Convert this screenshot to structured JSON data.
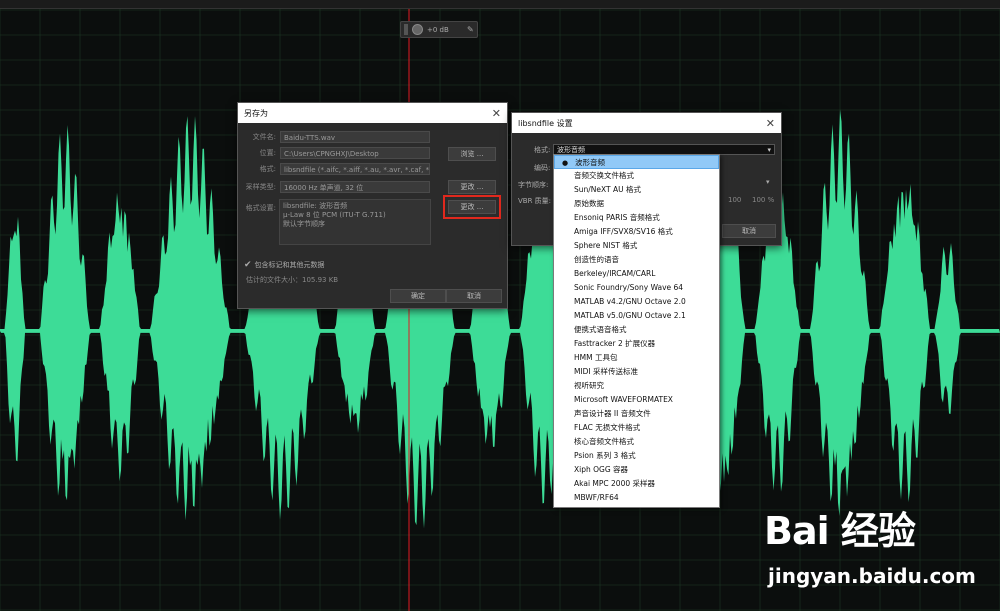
{
  "colors": {
    "waveform": "#3ddc97",
    "grid": "#1e3a26",
    "playhead": "#e01b24",
    "highlight": "#e0281d",
    "selection": "#91c9f7"
  },
  "volume": {
    "value": "+0 dB"
  },
  "save_as": {
    "title": "另存为",
    "fields": [
      {
        "label": "文件名:",
        "value": "Baidu-TTS.wav"
      },
      {
        "label": "位置:",
        "value": "C:\\Users\\CPNGHXJ\\Desktop"
      },
      {
        "label": "格式:",
        "value": "libsndfile (*.aifc, *.aiff, *.au, *.avr, *.caf, *.flac, *"
      },
      {
        "label": "采样类型:",
        "value": "16000 Hz 单声道, 32 位"
      }
    ],
    "format_settings_label": "格式设置:",
    "format_settings_lines": [
      "libsndfile: 波形音频",
      "μ-Law 8 位 PCM (ITU-T G.711)",
      "默认字节顺序"
    ],
    "browse_label": "浏览 ...",
    "change_label_1": "更改 ...",
    "change_label_2": "更改 ...",
    "include_label": "包含标记和其他元数据",
    "estimate_label": "估计的文件大小：105.93 KB",
    "ok_label": "确定",
    "cancel_label": "取消"
  },
  "libsndfile": {
    "title": "libsndfile 设置",
    "format_label": "格式:",
    "format_value": "波形音频",
    "encoding_label": "编码:",
    "byte_order_label": "字节顺序:",
    "vbr_label": "VBR 质量:",
    "vbr_value_1": "100",
    "vbr_value_2": "100 %",
    "cancel_label": "取消"
  },
  "dropdown": {
    "selected_index": 0,
    "items": [
      "波形音频",
      "音频交换文件格式",
      "Sun/NeXT AU 格式",
      "原始数据",
      "Ensoniq PARIS 音频格式",
      "Amiga IFF/SVX8/SV16 格式",
      "Sphere NIST 格式",
      "创造性的语音",
      "Berkeley/IRCAM/CARL",
      "Sonic Foundry/Sony Wave 64",
      "MATLAB v4.2/GNU Octave 2.0",
      "MATLAB v5.0/GNU Octave 2.1",
      "便携式语音格式",
      "Fasttracker 2 扩展仪器",
      "HMM 工具包",
      "MIDI 采样传送标准",
      "视听研究",
      "Microsoft WAVEFORMATEX",
      "声音设计器 II 音频文件",
      "FLAC 无损文件格式",
      "核心音频文件格式",
      "Psion 系列 3 格式",
      "Xiph OGG 容器",
      "Akai MPC 2000 采样器",
      "MBWF/RF64"
    ]
  },
  "watermark": {
    "logo": "Bai 经验",
    "url": "jingyan.baidu.com"
  }
}
